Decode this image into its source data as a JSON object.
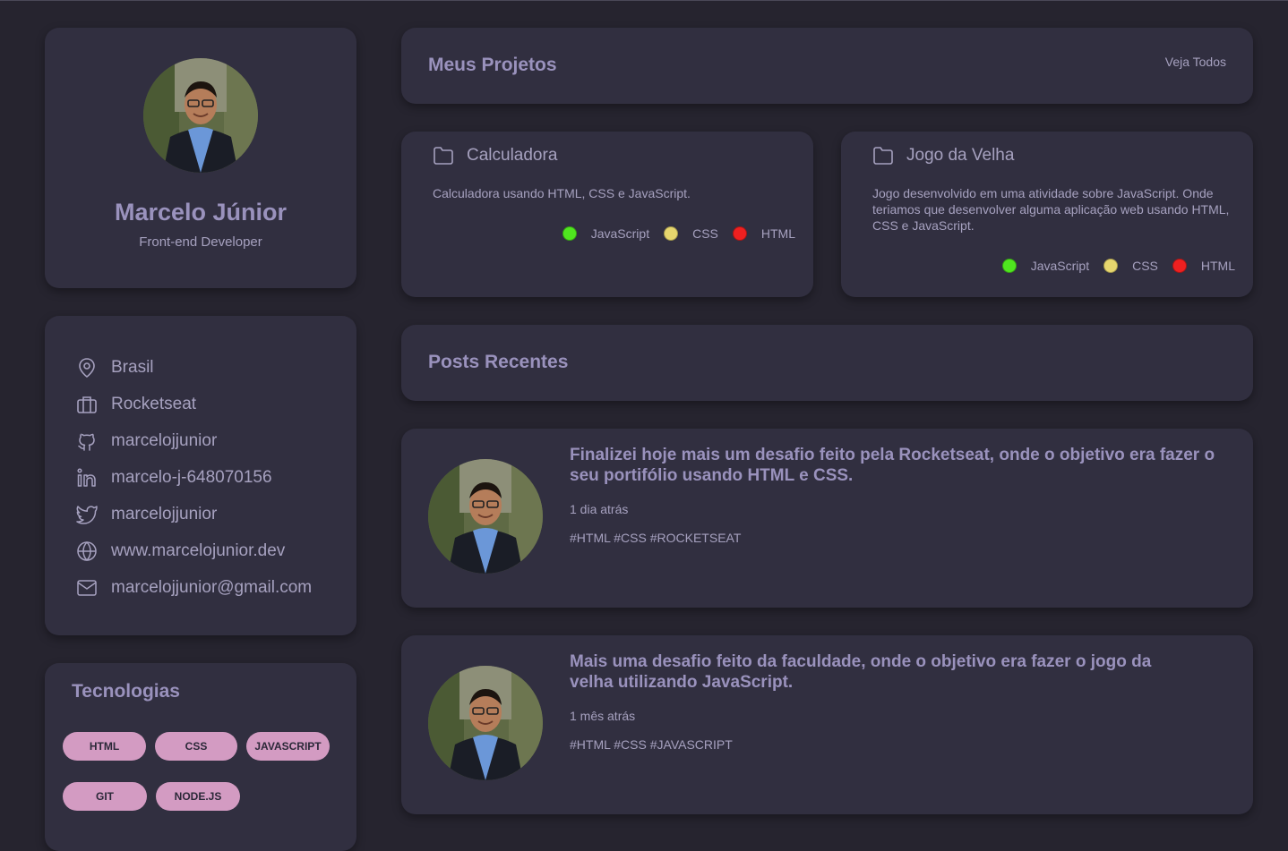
{
  "profile": {
    "name": "Marcelo Júnior",
    "role": "Front-end Developer"
  },
  "contacts": [
    {
      "icon": "map-pin-icon",
      "label": "Brasil"
    },
    {
      "icon": "briefcase-icon",
      "label": "Rocketseat"
    },
    {
      "icon": "github-icon",
      "label": "marcelojjunior"
    },
    {
      "icon": "linkedin-icon",
      "label": "marcelo-j-648070156"
    },
    {
      "icon": "twitter-icon",
      "label": "marcelojjunior"
    },
    {
      "icon": "globe-icon",
      "label": "www.marcelojunior.dev"
    },
    {
      "icon": "mail-icon",
      "label": "marcelojjunior@gmail.com"
    }
  ],
  "techs": {
    "title": "Tecnologias",
    "items": [
      "HTML",
      "CSS",
      "JAVASCRIPT",
      "GIT",
      "NODE.JS"
    ]
  },
  "projects": {
    "title": "Meus Projetos",
    "see_all": "Veja Todos",
    "items": [
      {
        "name": "Calculadora",
        "description": "Calculadora usando HTML, CSS e JavaScript.",
        "langs": [
          "JavaScript",
          "CSS",
          "HTML"
        ]
      },
      {
        "name": "Jogo da Velha",
        "description": "Jogo desenvolvido em uma atividade sobre JavaScript. Onde teriamos que desenvolver alguma aplicação web usando HTML, CSS e JavaScript.",
        "langs": [
          "JavaScript",
          "CSS",
          "HTML"
        ]
      }
    ],
    "lang_colors": {
      "JavaScript": "#4fe51f",
      "CSS": "#e6d66e",
      "HTML": "#ee2020"
    }
  },
  "posts": {
    "title": "Posts Recentes",
    "items": [
      {
        "title": "Finalizei hoje mais um desafio feito pela Rocketseat, onde o objetivo era fazer o seu portifólio usando HTML e CSS.",
        "date": "1 dia atrás",
        "tags": "#HTML #CSS #ROCKETSEAT"
      },
      {
        "title": "Mais uma desafio feito da faculdade, onde o objetivo era fazer o jogo da velha utilizando JavaScript.",
        "date": "1 mês atrás",
        "tags": "#HTML #CSS #JAVASCRIPT"
      }
    ]
  },
  "colors": {
    "background": "#26242f",
    "card": "#312f40",
    "accent_text": "#9a92bd",
    "tag": "#d39bc2"
  }
}
